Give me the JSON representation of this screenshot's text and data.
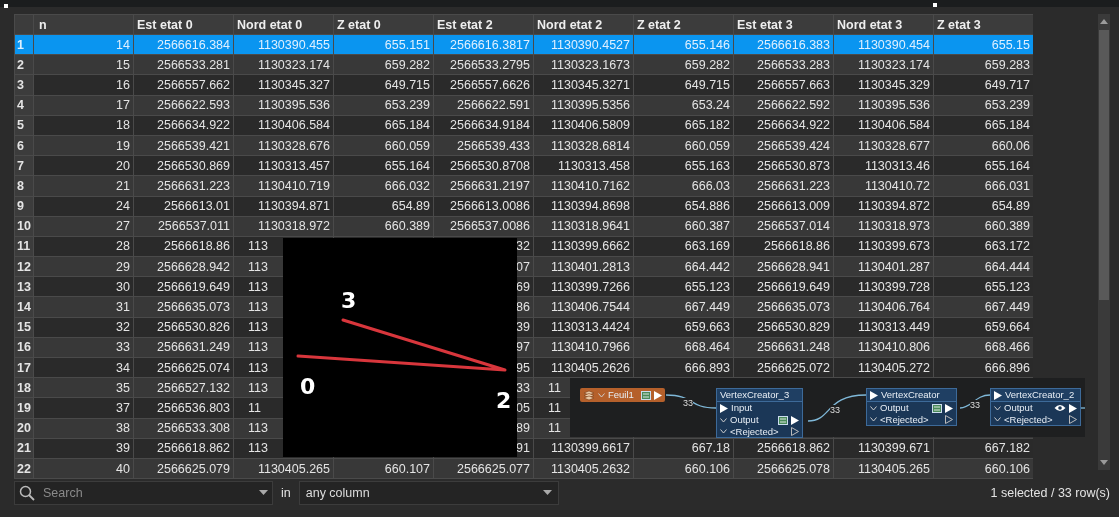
{
  "table": {
    "columns": [
      "n",
      "Est etat 0",
      "Nord etat 0",
      "Z etat 0",
      "Est etat 2",
      "Nord etat 2",
      "Z etat 2",
      "Est etat 3",
      "Nord etat 3",
      "Z etat 3"
    ],
    "rows": [
      {
        "number": "1",
        "selected": true,
        "cells": [
          "14",
          "2566616.384",
          "1130390.455",
          "655.151",
          "2566616.3817",
          "1130390.4527",
          "655.146",
          "2566616.383",
          "1130390.454",
          "655.15"
        ]
      },
      {
        "number": "2",
        "selected": false,
        "cells": [
          "15",
          "2566533.281",
          "1130323.174",
          "659.282",
          "2566533.2795",
          "1130323.1673",
          "659.282",
          "2566533.283",
          "1130323.174",
          "659.283"
        ]
      },
      {
        "number": "3",
        "selected": false,
        "cells": [
          "16",
          "2566557.662",
          "1130345.327",
          "649.715",
          "2566557.6626",
          "1130345.3271",
          "649.715",
          "2566557.663",
          "1130345.329",
          "649.717"
        ]
      },
      {
        "number": "4",
        "selected": false,
        "cells": [
          "17",
          "2566622.593",
          "1130395.536",
          "653.239",
          "2566622.591",
          "1130395.5356",
          "653.24",
          "2566622.592",
          "1130395.536",
          "653.239"
        ]
      },
      {
        "number": "5",
        "selected": false,
        "cells": [
          "18",
          "2566634.922",
          "1130406.584",
          "665.184",
          "2566634.9184",
          "1130406.5809",
          "665.182",
          "2566634.922",
          "1130406.584",
          "665.184"
        ]
      },
      {
        "number": "6",
        "selected": false,
        "cells": [
          "19",
          "2566539.421",
          "1130328.676",
          "660.059",
          "2566539.433",
          "1130328.6814",
          "660.059",
          "2566539.424",
          "1130328.677",
          "660.06"
        ]
      },
      {
        "number": "7",
        "selected": false,
        "cells": [
          "20",
          "2566530.869",
          "1130313.457",
          "655.164",
          "2566530.8708",
          "1130313.458",
          "655.163",
          "2566530.873",
          "1130313.46",
          "655.164"
        ]
      },
      {
        "number": "8",
        "selected": false,
        "cells": [
          "21",
          "2566631.223",
          "1130410.719",
          "666.032",
          "2566631.2197",
          "1130410.7162",
          "666.03",
          "2566631.223",
          "1130410.72",
          "666.031"
        ]
      },
      {
        "number": "9",
        "selected": false,
        "cells": [
          "24",
          "2566613.01",
          "1130394.871",
          "654.89",
          "2566613.0086",
          "1130394.8698",
          "654.886",
          "2566613.009",
          "1130394.872",
          "654.89"
        ]
      },
      {
        "number": "10",
        "selected": false,
        "cells": [
          "27",
          "2566537.011",
          "1130318.972",
          "660.389",
          "2566537.0086",
          "1130318.9641",
          "660.387",
          "2566537.014",
          "1130318.973",
          "660.389"
        ]
      },
      {
        "number": "11",
        "selected": false,
        "cells": [
          "28",
          "2566618.86",
          {
            "text": "113",
            "cut": true
          },
          null,
          "32",
          "1130399.6662",
          "663.169",
          "2566618.86",
          "1130399.673",
          "663.172"
        ]
      },
      {
        "number": "12",
        "selected": false,
        "cells": [
          "29",
          "2566628.942",
          {
            "text": "113",
            "cut": true
          },
          null,
          "07",
          "1130401.2813",
          "664.442",
          "2566628.941",
          "1130401.287",
          "664.444"
        ]
      },
      {
        "number": "13",
        "selected": false,
        "cells": [
          "30",
          "2566619.649",
          {
            "text": "113",
            "cut": true
          },
          null,
          "69",
          "1130399.7266",
          "655.123",
          "2566619.649",
          "1130399.728",
          "655.123"
        ]
      },
      {
        "number": "14",
        "selected": false,
        "cells": [
          "31",
          "2566635.073",
          {
            "text": "113",
            "cut": true
          },
          null,
          "86",
          "1130406.7544",
          "667.449",
          "2566635.073",
          "1130406.764",
          "667.449"
        ]
      },
      {
        "number": "15",
        "selected": false,
        "cells": [
          "32",
          "2566530.826",
          {
            "text": "113",
            "cut": true
          },
          null,
          "39",
          "1130313.4424",
          "659.663",
          "2566530.829",
          "1130313.449",
          "659.664"
        ]
      },
      {
        "number": "16",
        "selected": false,
        "cells": [
          "33",
          "2566631.249",
          {
            "text": "113",
            "cut": true
          },
          null,
          "97",
          "1130410.7966",
          "668.464",
          "2566631.248",
          "1130410.806",
          "668.466"
        ]
      },
      {
        "number": "17",
        "selected": false,
        "cells": [
          "34",
          "2566625.074",
          {
            "text": "113",
            "cut": true
          },
          null,
          "95",
          "1130405.2626",
          "666.893",
          "2566625.072",
          "1130405.272",
          "666.896"
        ]
      },
      {
        "number": "18",
        "selected": false,
        "cells": [
          "35",
          "2566527.132",
          {
            "text": "113",
            "cut": true
          },
          null,
          "33",
          {
            "text": "11",
            "cut": true
          },
          null,
          null,
          null,
          null
        ]
      },
      {
        "number": "19",
        "selected": false,
        "cells": [
          "37",
          "2566536.803",
          {
            "text": "11",
            "cut": true
          },
          null,
          "05",
          {
            "text": "11",
            "cut": true
          },
          null,
          null,
          null,
          null
        ]
      },
      {
        "number": "20",
        "selected": false,
        "cells": [
          "38",
          "2566533.308",
          {
            "text": "113",
            "cut": true
          },
          null,
          "89",
          {
            "text": "11",
            "cut": true
          },
          null,
          null,
          null,
          null
        ]
      },
      {
        "number": "21",
        "selected": false,
        "cells": [
          "39",
          "2566618.862",
          {
            "text": "113",
            "cut": true
          },
          null,
          "91",
          "1130399.6617",
          "667.18",
          "2566618.862",
          "1130399.671",
          "667.182"
        ]
      },
      {
        "number": "22",
        "selected": false,
        "cells": [
          "40",
          "2566625.079",
          "1130405.265",
          "660.107",
          "2566625.077",
          "1130405.2632",
          "660.106",
          "2566625.078",
          "1130405.265",
          "660.106"
        ]
      }
    ]
  },
  "viewer": {
    "labels": [
      "3",
      "0",
      "2"
    ]
  },
  "workflow": {
    "nodes": [
      {
        "kind": "reader",
        "title": "Feuil1",
        "badge": {
          "kind": "inspect"
        }
      },
      {
        "kind": "transformer",
        "title": "VertexCreator_3",
        "header_port": false,
        "ports": [
          {
            "kind": "input",
            "label": "Input"
          },
          {
            "kind": "output",
            "label": "Output",
            "badge": {
              "kind": "inspect"
            }
          },
          {
            "kind": "rejected",
            "label": "<Rejected>"
          }
        ]
      },
      {
        "kind": "transformer",
        "title": "VertexCreator",
        "header_port": true,
        "ports": [
          {
            "kind": "output",
            "label": "Output",
            "badge": {
              "kind": "inspect"
            }
          },
          {
            "kind": "rejected",
            "label": "<Rejected>"
          }
        ]
      },
      {
        "kind": "transformer",
        "title": "VertexCreator_2",
        "header_port": true,
        "ports": [
          {
            "kind": "output",
            "label": "Output",
            "badge": {
              "kind": "eye"
            }
          },
          {
            "kind": "rejected",
            "label": "<Rejected>"
          }
        ]
      }
    ],
    "counts": [
      "33",
      "33",
      "33"
    ]
  },
  "filter": {
    "placeholder": "Search",
    "in_label": "in",
    "column": "any column"
  },
  "status": "1 selected / 33 row(s)"
}
